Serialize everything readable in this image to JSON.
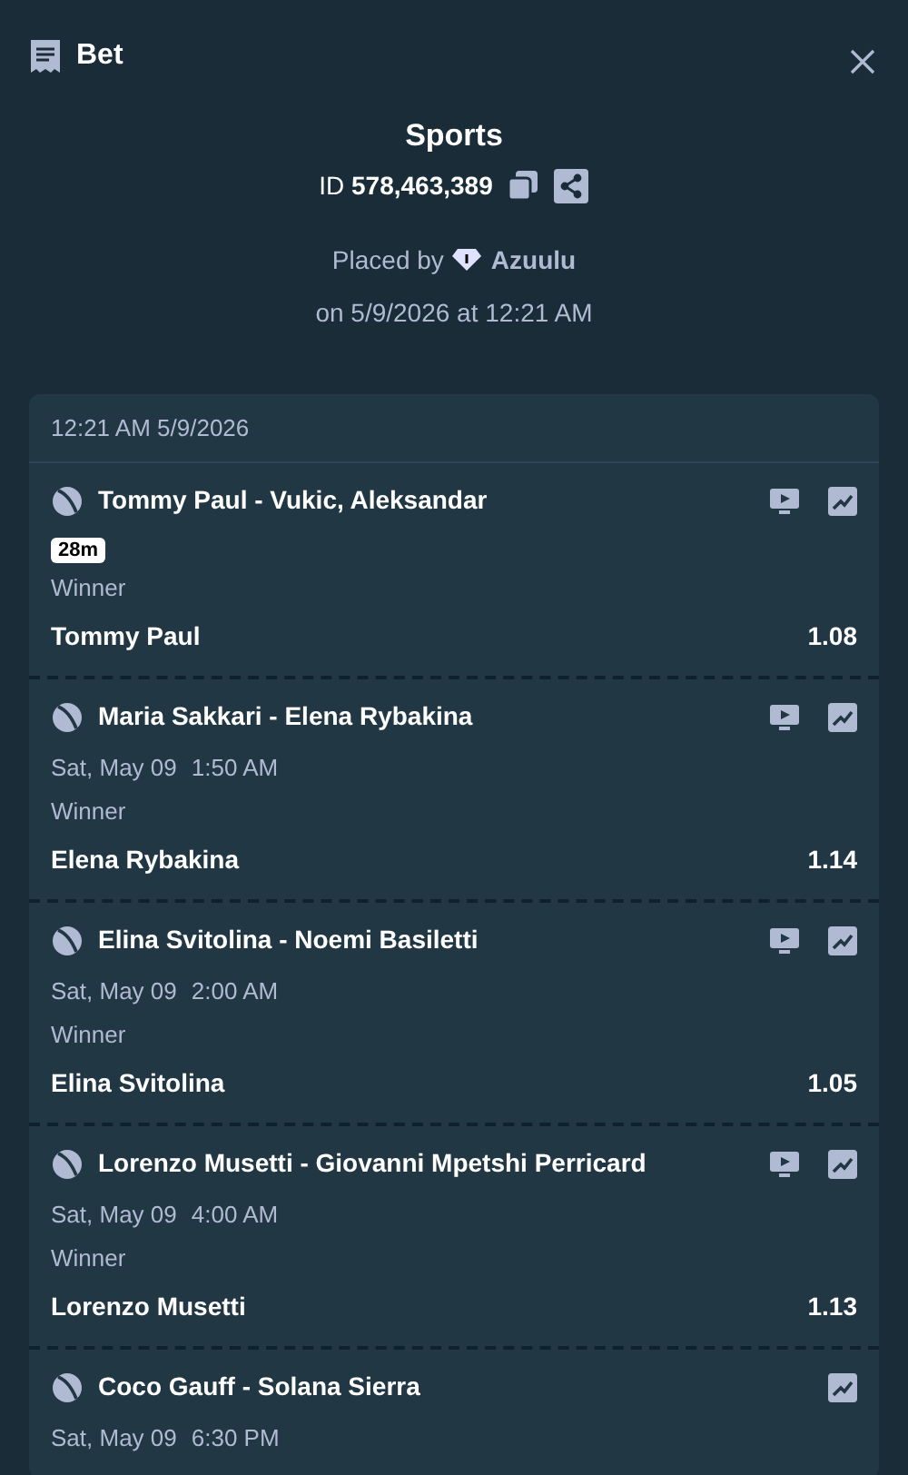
{
  "header": {
    "title": "Bet"
  },
  "summary": {
    "title": "Sports",
    "id_label": "ID",
    "id_value": "578,463,389",
    "placed_by_label": "Placed by",
    "user": "Azuulu",
    "placed_on": "on 5/9/2026 at 12:21 AM"
  },
  "slip": {
    "timestamp": "12:21 AM 5/9/2026",
    "legs": [
      {
        "match": "Tommy Paul - Vukic, Aleksandar",
        "stream": true,
        "live_badge": "28m",
        "market": "Winner",
        "selection": "Tommy Paul",
        "odds": "1.08"
      },
      {
        "match": "Maria Sakkari - Elena Rybakina",
        "stream": true,
        "date": "Sat, May 09",
        "time": "1:50 AM",
        "market": "Winner",
        "selection": "Elena Rybakina",
        "odds": "1.14"
      },
      {
        "match": "Elina Svitolina - Noemi Basiletti",
        "stream": true,
        "date": "Sat, May 09",
        "time": "2:00 AM",
        "market": "Winner",
        "selection": "Elina Svitolina",
        "odds": "1.05"
      },
      {
        "match": "Lorenzo Musetti - Giovanni Mpetshi Perricard",
        "stream": true,
        "date": "Sat, May 09",
        "time": "4:00 AM",
        "market": "Winner",
        "selection": "Lorenzo Musetti",
        "odds": "1.13"
      },
      {
        "match": "Coco Gauff - Solana Sierra",
        "stream": false,
        "date": "Sat, May 09",
        "time": "6:30 PM"
      }
    ]
  }
}
